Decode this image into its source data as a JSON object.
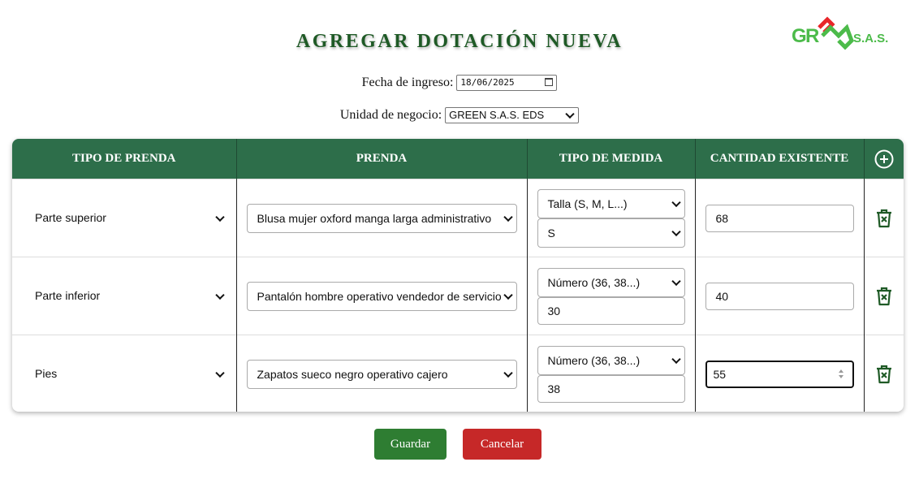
{
  "title": "AGREGAR DOTACIÓN NUEVA",
  "logo": {
    "text": "GREEN S.A.S.",
    "brand_green": "#4cbb4a",
    "brand_red": "#e8262a"
  },
  "form": {
    "date_label": "Fecha de ingreso:",
    "date_value": "18/06/2025",
    "unit_label": "Unidad de negocio:",
    "unit_value": "GREEN S.A.S. EDS"
  },
  "table": {
    "header_color": "#2d6e4a",
    "columns": [
      "TIPO DE PRENDA",
      "PRENDA",
      "TIPO DE MEDIDA",
      "CANTIDAD EXISTENTE"
    ],
    "add_icon": "plus-circle-icon",
    "rows": [
      {
        "tipo": "Parte superior",
        "prenda": "Blusa mujer oxford manga larga administrativo",
        "medida_tipo": "Talla (S, M, L...)",
        "medida_valor": "S",
        "medida_valor_is_select": true,
        "cantidad": "68"
      },
      {
        "tipo": "Parte inferior",
        "prenda": "Pantalón hombre operativo vendedor de servicio",
        "medida_tipo": "Número (36, 38...)",
        "medida_valor": "30",
        "medida_valor_is_select": false,
        "cantidad": "40"
      },
      {
        "tipo": "Pies",
        "prenda": "Zapatos sueco negro operativo cajero",
        "medida_tipo": "Número (36, 38...)",
        "medida_valor": "38",
        "medida_valor_is_select": false,
        "cantidad": "55"
      }
    ]
  },
  "buttons": {
    "save": "Guardar",
    "cancel": "Cancelar",
    "save_color": "#2e7d32",
    "cancel_color": "#c62828"
  }
}
